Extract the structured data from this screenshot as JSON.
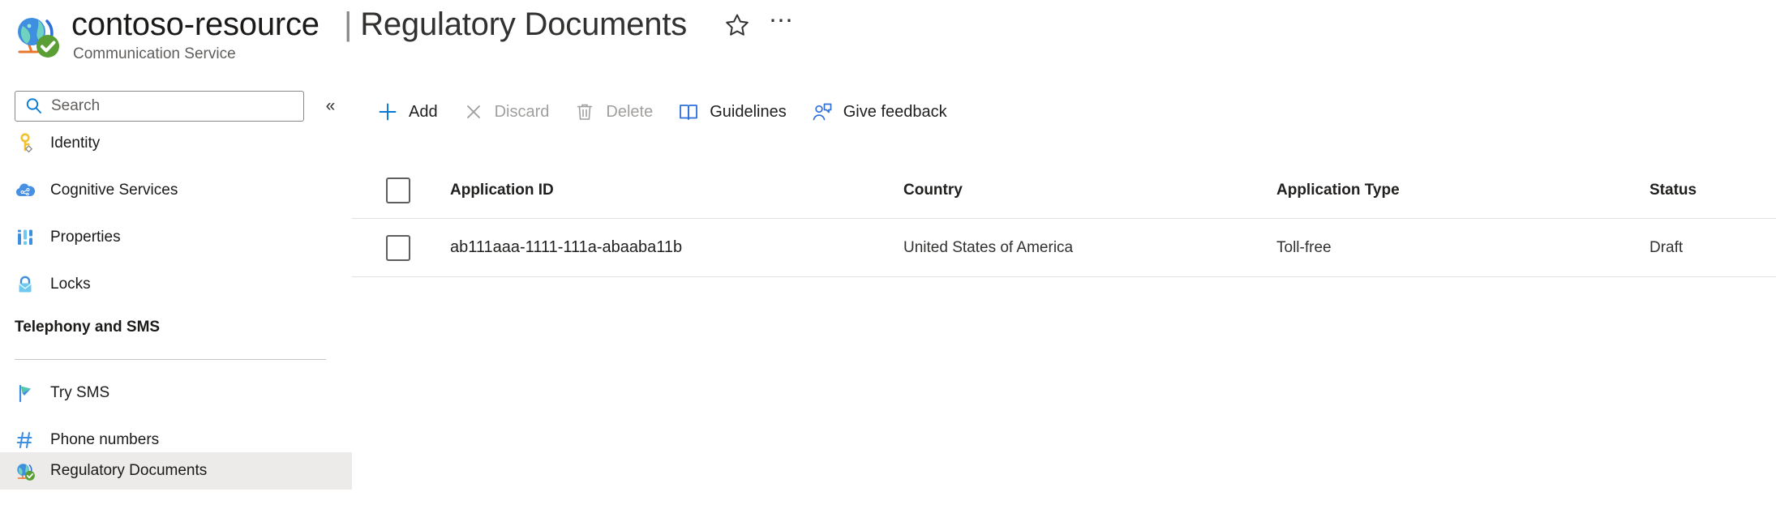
{
  "header": {
    "resource_icon": "globe-check-icon",
    "resource_name": "contoso-resource",
    "resource_type": "Communication Service",
    "separator": "|",
    "page_title": "Regulatory Documents",
    "favorite_icon": "star-icon",
    "more_icon": "ellipsis-icon",
    "more_label": "⋯"
  },
  "sidebar": {
    "search": {
      "icon": "search-icon",
      "value": "",
      "placeholder": "Search"
    },
    "collapse": {
      "icon": "chevron-double-left-icon",
      "label": "«"
    },
    "items": [
      {
        "label": "Identity",
        "icon": "key-icon",
        "selected": false
      },
      {
        "label": "Cognitive Services",
        "icon": "cognitive-services-icon",
        "selected": false
      },
      {
        "label": "Properties",
        "icon": "properties-icon",
        "selected": false
      },
      {
        "label": "Locks",
        "icon": "lock-icon",
        "selected": false
      }
    ],
    "group": {
      "title": "Telephony and SMS",
      "items": [
        {
          "label": "Try SMS",
          "icon": "flag-icon",
          "selected": false
        },
        {
          "label": "Phone numbers",
          "icon": "hash-icon",
          "selected": false
        },
        {
          "label": "Regulatory Documents",
          "icon": "globe-check-icon",
          "selected": true
        }
      ]
    }
  },
  "toolbar": {
    "commands": [
      {
        "label": "Add",
        "icon": "plus-icon",
        "disabled": false
      },
      {
        "label": "Discard",
        "icon": "close-icon",
        "disabled": true
      },
      {
        "label": "Delete",
        "icon": "trash-icon",
        "disabled": true
      },
      {
        "label": "Guidelines",
        "icon": "book-icon",
        "disabled": false
      },
      {
        "label": "Give feedback",
        "icon": "person-feedback-icon",
        "disabled": false
      }
    ]
  },
  "table": {
    "select_all": {
      "icon": "checkbox-unchecked-icon",
      "checked": false
    },
    "columns": [
      "Application ID",
      "Country",
      "Application Type",
      "Status"
    ],
    "rows": [
      {
        "checked": false,
        "application_id": "ab111aaa-1111-111a-abaaba11b",
        "country": "United States of America",
        "application_type": "Toll-free",
        "status": "Draft"
      }
    ]
  },
  "colors": {
    "accent": "#0078d4",
    "selected_row_bg": "#edebe9",
    "border": "#e1dfdd",
    "disabled_text": "#a19f9d"
  }
}
